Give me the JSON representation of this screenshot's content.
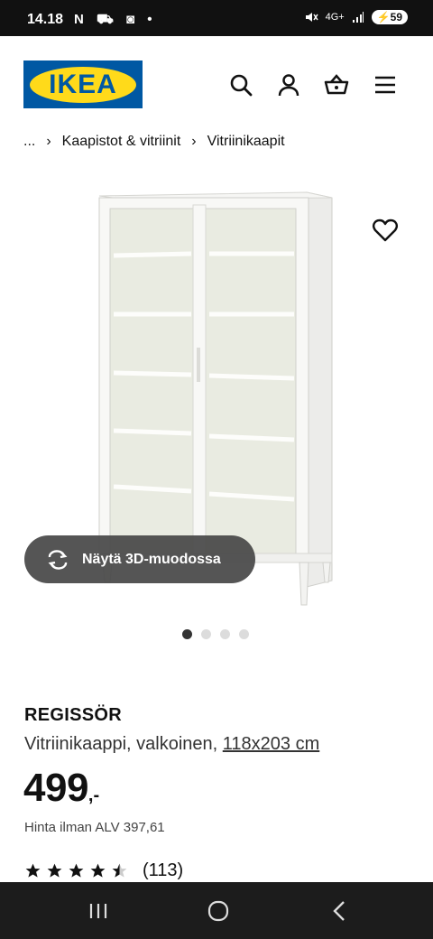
{
  "status_bar": {
    "time": "14.18",
    "left_icons": "N ⛟ ◙ •",
    "network": "4G+",
    "battery": "59"
  },
  "header": {
    "logo_text": "IKEA",
    "colors": {
      "brand_blue": "#0058a3",
      "brand_yellow": "#ffda1a"
    },
    "icons": [
      "search-icon",
      "account-icon",
      "cart-icon",
      "menu-icon"
    ]
  },
  "breadcrumb": {
    "ellipsis": "...",
    "items": [
      "Kaapistot & vitriinit",
      "Vitriinikaapit"
    ]
  },
  "gallery": {
    "view_3d_label": "Näytä 3D-muodossa",
    "slide_count": 4,
    "active_slide": 1
  },
  "product": {
    "name": "REGISSÖR",
    "description": "Vitriinikaappi, valkoinen,",
    "size": "118x203 cm",
    "price": "499",
    "price_suffix": ",-",
    "vat_text": "Hinta ilman ALV 397,61",
    "rating": 4.5,
    "reviews": "(113)"
  }
}
